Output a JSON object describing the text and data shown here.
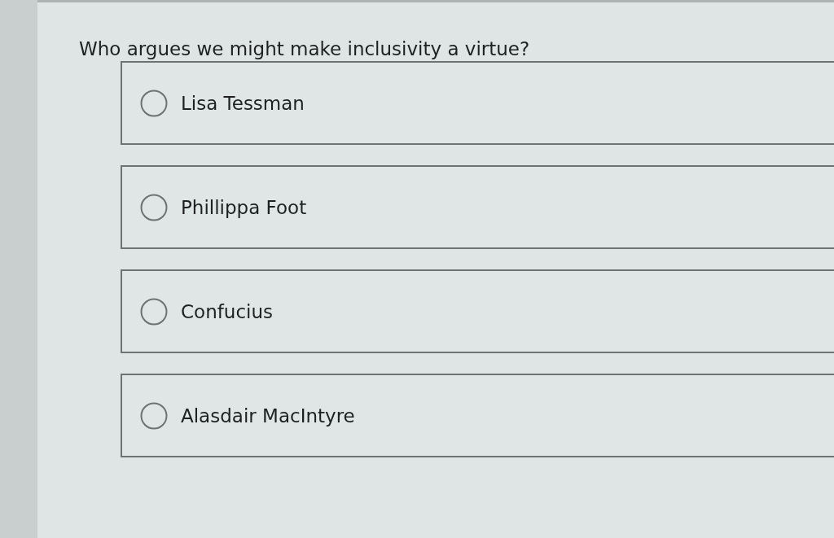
{
  "question": {
    "text": "Who argues we might make inclusivity a virtue?"
  },
  "options": [
    {
      "label": "Lisa Tessman",
      "selected": false
    },
    {
      "label": "Phillippa Foot",
      "selected": false
    },
    {
      "label": "Confucius",
      "selected": false
    },
    {
      "label": "Alasdair MacIntyre",
      "selected": false
    }
  ]
}
